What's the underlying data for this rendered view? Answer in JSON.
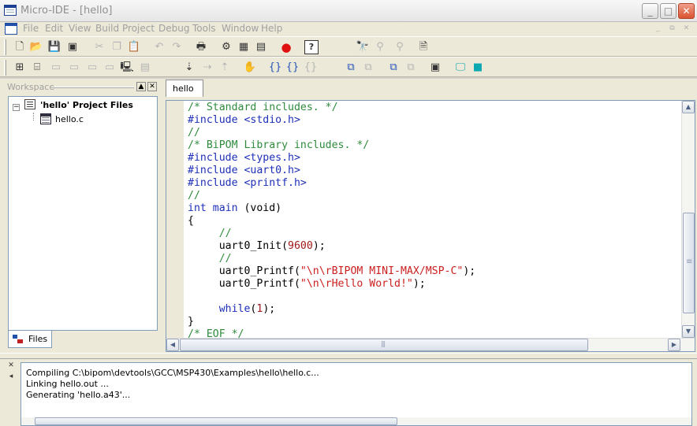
{
  "window": {
    "title": "Micro-IDE - [hello]",
    "minimize": "_",
    "maximize": "□",
    "close": "✕"
  },
  "menu": {
    "items": [
      "File",
      "Edit",
      "View",
      "Build",
      "Project",
      "Debug",
      "Tools",
      "Window",
      "Help"
    ],
    "mdi_min": "_",
    "mdi_restore": "⧉",
    "mdi_close": "✕"
  },
  "toolbar1": {
    "icons": [
      "new-file",
      "open-folder",
      "save",
      "save-all",
      "cut",
      "copy",
      "paste",
      "undo",
      "redo",
      "print",
      "compile",
      "build",
      "build-all",
      "stop-build",
      "help",
      "find",
      "find-next",
      "find-prev",
      "find-in-files"
    ]
  },
  "toolbar2": {
    "icons": [
      "workspace-toggle",
      "output-toggle",
      "watch",
      "registers",
      "memory",
      "terminal",
      "disassembly",
      "step-into",
      "step-over",
      "step-out",
      "breakpoint-hand",
      "brace-match",
      "brace-next",
      "brace-prev",
      "download",
      "run",
      "reset",
      "properties",
      "monitor",
      "board"
    ]
  },
  "workspace": {
    "title": "Workspace",
    "pin": "▲",
    "close": "✕",
    "project_label": "'hello' Project Files",
    "toggle": "−",
    "file_label": "hello.c",
    "tab_label": "Files"
  },
  "editor": {
    "tab_label": "hello",
    "code_lines": [
      [
        {
          "t": "/* Standard includes. */",
          "c": "c-com"
        }
      ],
      [
        {
          "t": "#include <stdio.h>",
          "c": "c-pp"
        }
      ],
      [
        {
          "t": "//",
          "c": "c-com"
        }
      ],
      [
        {
          "t": "/* BiPOM Library includes. */",
          "c": "c-com"
        }
      ],
      [
        {
          "t": "#include <types.h>",
          "c": "c-pp"
        }
      ],
      [
        {
          "t": "#include <uart0.h>",
          "c": "c-pp"
        }
      ],
      [
        {
          "t": "#include <printf.h>",
          "c": "c-pp"
        }
      ],
      [
        {
          "t": "//",
          "c": "c-com"
        }
      ],
      [
        {
          "t": "int",
          "c": "c-kw"
        },
        {
          "t": " "
        },
        {
          "t": "main",
          "c": "c-kw"
        },
        {
          "t": " (void)"
        }
      ],
      [
        {
          "t": "{"
        }
      ],
      [
        {
          "t": "     "
        },
        {
          "t": "//",
          "c": "c-com"
        }
      ],
      [
        {
          "t": "     uart0_Init("
        },
        {
          "t": "9600",
          "c": "c-num"
        },
        {
          "t": ");"
        }
      ],
      [
        {
          "t": "     "
        },
        {
          "t": "//",
          "c": "c-com"
        }
      ],
      [
        {
          "t": "     uart0_Printf("
        },
        {
          "t": "\"\\n\\rBIPOM MINI-MAX/MSP-C\"",
          "c": "c-str"
        },
        {
          "t": ");"
        }
      ],
      [
        {
          "t": "     uart0_Printf("
        },
        {
          "t": "\"\\n\\rHello World!\"",
          "c": "c-str"
        },
        {
          "t": ");"
        }
      ],
      [
        {
          "t": ""
        }
      ],
      [
        {
          "t": "     "
        },
        {
          "t": "while",
          "c": "c-kw"
        },
        {
          "t": "("
        },
        {
          "t": "1",
          "c": "c-num"
        },
        {
          "t": ");"
        }
      ],
      [
        {
          "t": "}"
        }
      ],
      [
        {
          "t": "/* EOF */",
          "c": "c-com"
        }
      ]
    ],
    "scroll_up": "▲",
    "scroll_down": "▼",
    "scroll_left": "◀",
    "scroll_right": "▶"
  },
  "output": {
    "close": "✕",
    "pin": "◂",
    "lines": [
      "Compiling C:\\bipom\\devtools\\GCC\\MSP430\\Examples\\hello\\hello.c...",
      "Linking hello.out ...",
      "Generating 'hello.a43'..."
    ],
    "scroll_left": "◀"
  }
}
